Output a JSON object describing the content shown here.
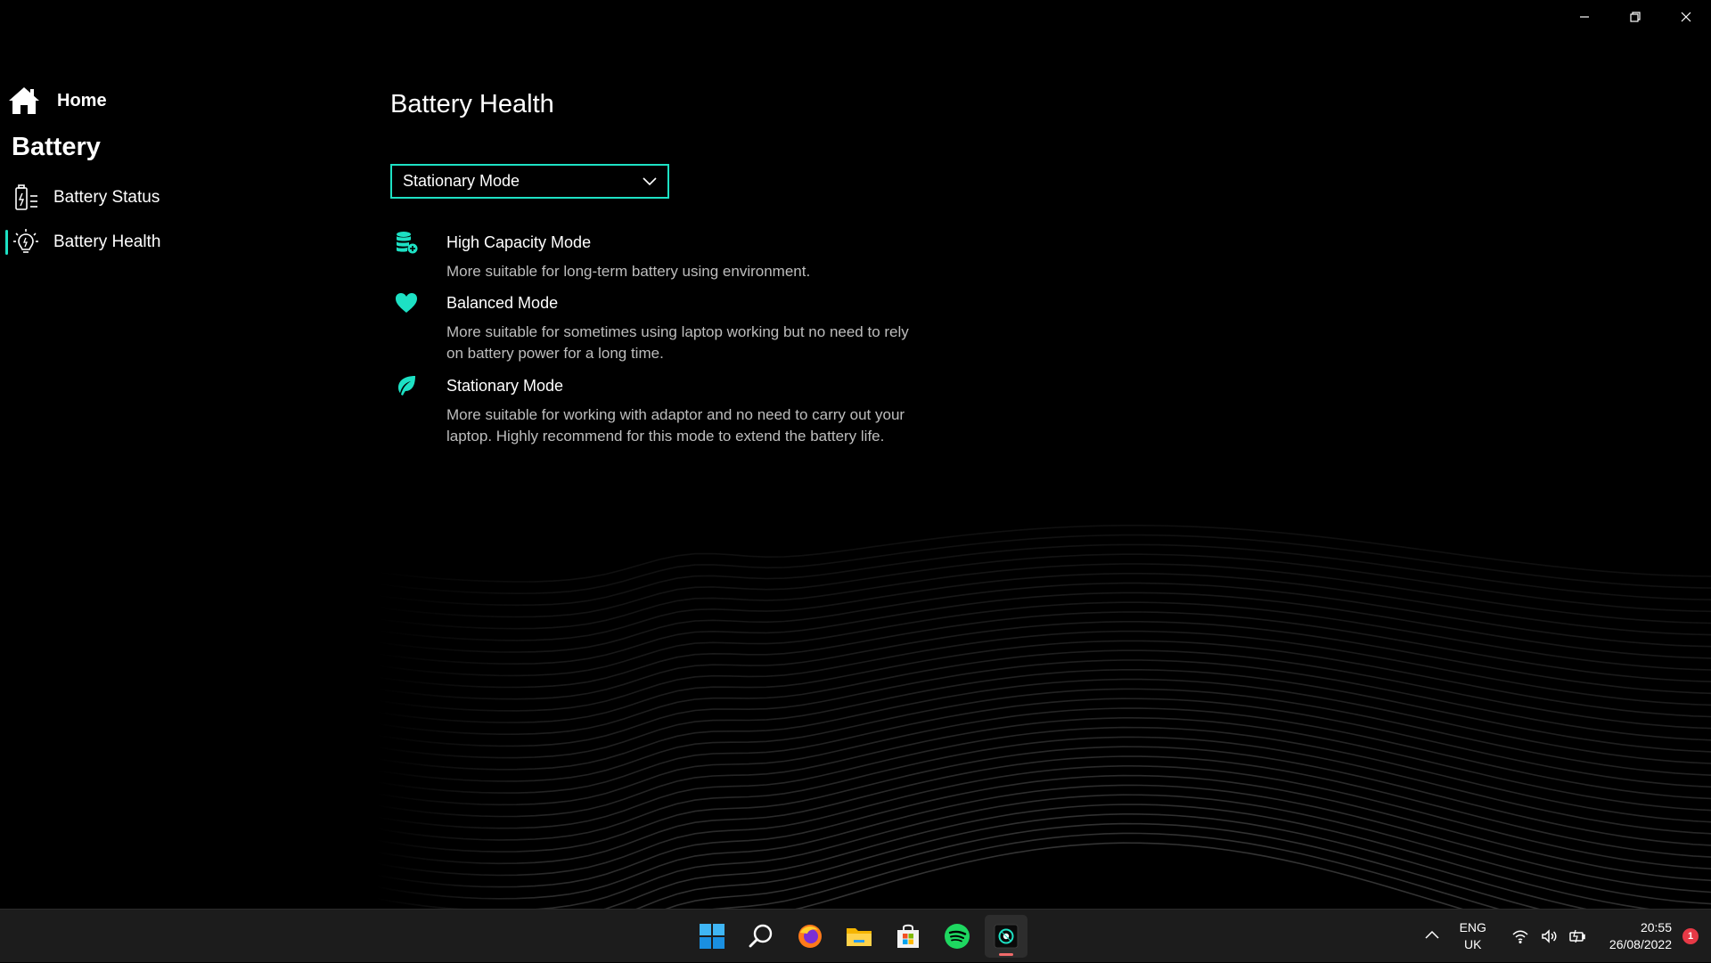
{
  "window": {
    "minimize_label": "Minimize",
    "restore_label": "Restore",
    "close_label": "Close"
  },
  "sidebar": {
    "home_label": "Home",
    "section_title": "Battery",
    "items": [
      {
        "label": "Battery Status",
        "icon": "battery-status-icon",
        "active": false
      },
      {
        "label": "Battery Health",
        "icon": "battery-health-icon",
        "active": true
      }
    ]
  },
  "main": {
    "title": "Battery Health",
    "dropdown": {
      "selected": "Stationary Mode"
    },
    "modes": [
      {
        "title": "High Capacity Mode",
        "icon": "database-plus-icon",
        "description": "More suitable for long-term battery using environment."
      },
      {
        "title": "Balanced Mode",
        "icon": "heart-icon",
        "description": "More suitable for sometimes using laptop working but no need to rely on battery power for a long time."
      },
      {
        "title": "Stationary Mode",
        "icon": "leaf-icon",
        "description": "More suitable for working with adaptor and no need to carry out your laptop. Highly recommend for this mode to extend the battery life."
      }
    ],
    "accent_color": "#1de1c4"
  },
  "taskbar": {
    "apps": [
      "windows-start",
      "search",
      "firefox",
      "file-explorer",
      "microsoft-store",
      "spotify",
      "battery-app"
    ],
    "language": {
      "line1": "ENG",
      "line2": "UK"
    },
    "clock": {
      "time": "20:55",
      "date": "26/08/2022"
    },
    "notification_count": "1"
  }
}
